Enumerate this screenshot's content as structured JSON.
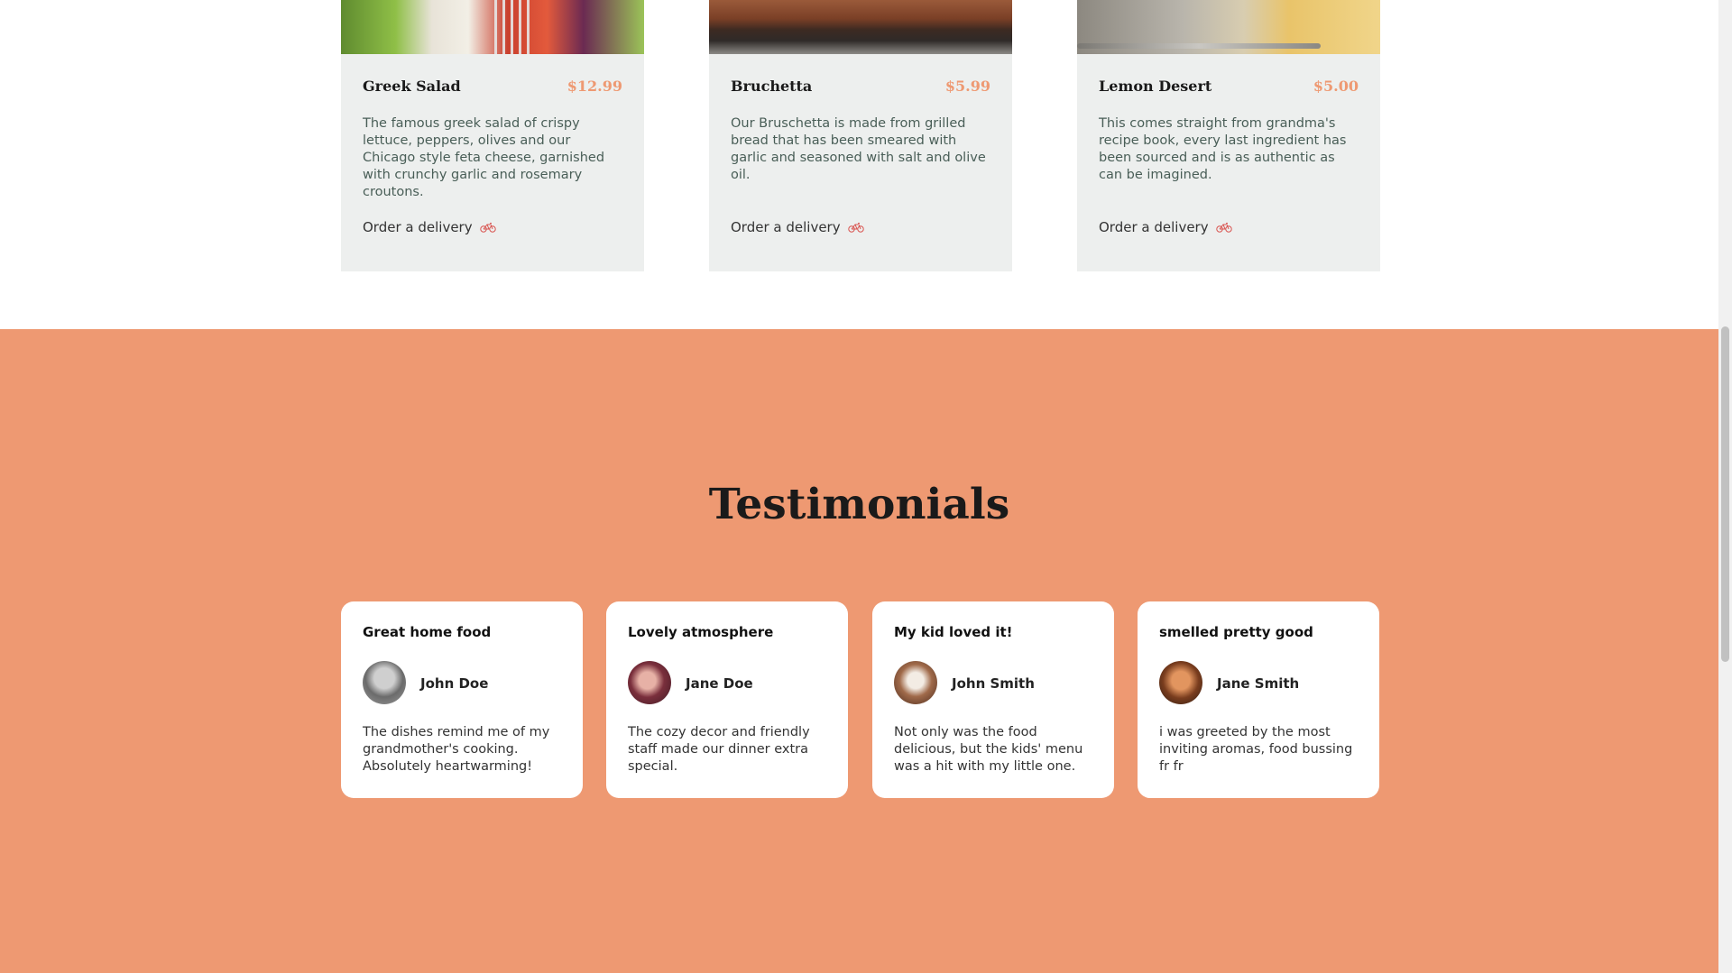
{
  "specials": {
    "items": [
      {
        "title": "Greek Salad",
        "price": "$12.99",
        "description": "The famous greek salad of crispy lettuce, peppers, olives and our Chicago style feta cheese, garnished with crunchy garlic and rosemary croutons.",
        "order_label": "Order a delivery",
        "icon": "bike-icon"
      },
      {
        "title": "Bruchetta",
        "price": "$5.99",
        "description": "Our Bruschetta is made from grilled bread that has been smeared with garlic and seasoned with salt and olive oil.",
        "order_label": "Order a delivery",
        "icon": "bike-icon"
      },
      {
        "title": "Lemon Desert",
        "price": "$5.00",
        "description": "This comes straight from grandma's recipe book, every last ingredient has been sourced and is as authentic as can be imagined.",
        "order_label": "Order a delivery",
        "icon": "bike-icon"
      }
    ]
  },
  "testimonials": {
    "heading": "Testimonials",
    "items": [
      {
        "title": "Great home food",
        "name": "John Doe",
        "text": "The dishes remind me of my grandmother's cooking. Absolutely heartwarming!"
      },
      {
        "title": "Lovely atmosphere",
        "name": "Jane Doe",
        "text": "The cozy decor and friendly staff made our dinner extra special."
      },
      {
        "title": "My kid loved it!",
        "name": "John Smith",
        "text": "Not only was the food delicious, but the kids' menu was a hit with my little one."
      },
      {
        "title": "smelled pretty good",
        "name": "Jane Smith",
        "text": "i was greeted by the most inviting aromas, food bussing fr fr"
      }
    ]
  },
  "colors": {
    "accent": "#ee9972",
    "card_background": "#edefee",
    "section_background": "#ee9972",
    "text_green": "#495e57"
  }
}
